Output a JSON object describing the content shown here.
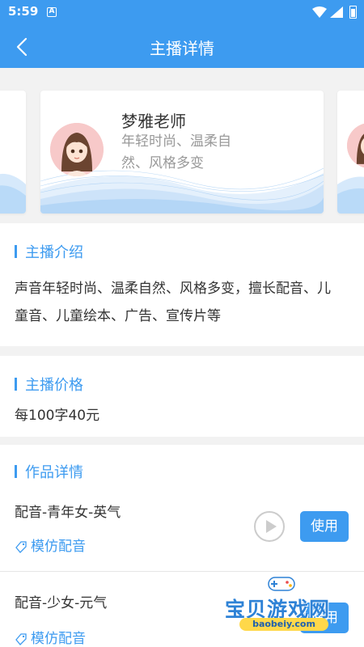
{
  "status": {
    "time": "5:59",
    "notif": "A"
  },
  "nav": {
    "title": "主播详情"
  },
  "anchor": {
    "name": "梦雅老师",
    "desc": "年轻时尚、温柔自然、风格多变"
  },
  "intro": {
    "heading": "主播介绍",
    "text": "声音年轻时尚、温柔自然、风格多变，擅长配音、儿童音、儿童绘本、广告、宣传片等"
  },
  "price": {
    "heading": "主播价格",
    "text": "每100字40元"
  },
  "works": {
    "heading": "作品详情",
    "items": [
      {
        "title": "配音-青年女-英气",
        "tag": "模仿配音",
        "use": "使用"
      },
      {
        "title": "配音-少女-元气",
        "tag": "模仿配音",
        "use": "使用"
      }
    ]
  },
  "watermark": {
    "text": "宝贝游戏网",
    "url": "baobeiy.com"
  },
  "colors": {
    "accent": "#3d9bf0",
    "background": "#f2f2f2"
  }
}
